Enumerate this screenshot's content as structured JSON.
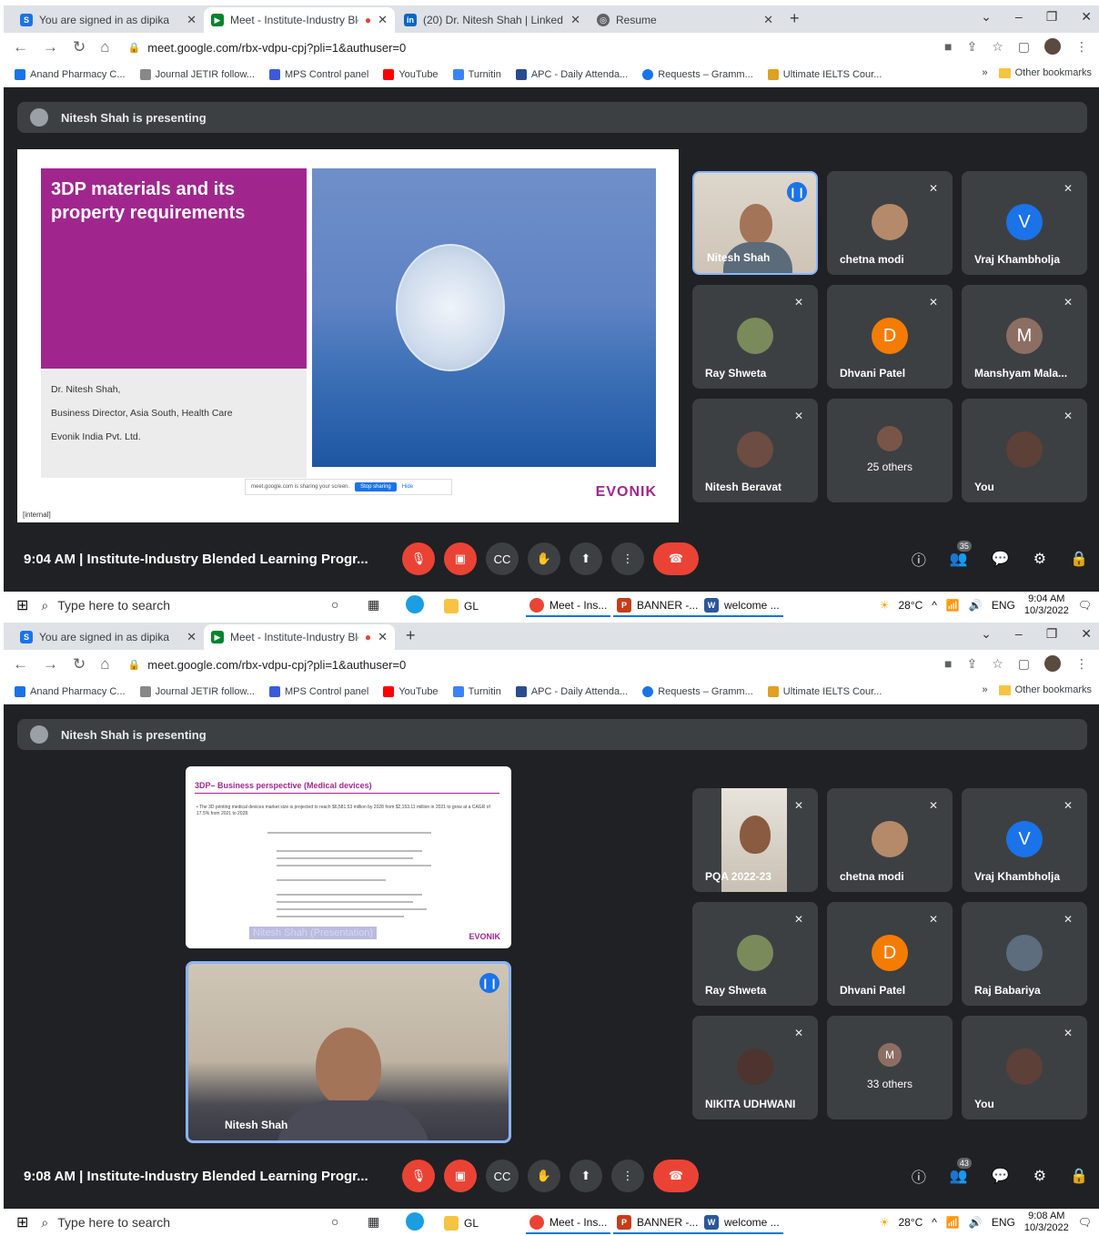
{
  "shots": [
    {
      "tabs": [
        "You are signed in as dipika",
        "Meet - Institute-Industry Ble",
        "(20) Dr. Nitesh Shah | LinkedIn",
        "Resume"
      ],
      "url": "meet.google.com/rbx-vdpu-cpj?pli=1&authuser=0",
      "presenting": "Nitesh Shah is presenting",
      "time_title": "9:04 AM  |  Institute-Industry Blended Learning Progr...",
      "people_count": "35",
      "tiles": [
        "Nitesh Shah",
        "chetna modi",
        "Vraj Khambholja",
        "Ray Shweta",
        "Dhvani Patel",
        "Manshyam Mala...",
        "Nitesh Beravat",
        "25 others",
        "You"
      ],
      "avatar_letters": [
        "V",
        "D",
        "M"
      ],
      "clock_time": "9:04 AM",
      "clock_date": "10/3/2022"
    },
    {
      "tabs": [
        "You are signed in as dipika",
        "Meet - Institute-Industry Ble"
      ],
      "url": "meet.google.com/rbx-vdpu-cpj?pli=1&authuser=0",
      "presenting": "Nitesh Shah is presenting",
      "time_title": "9:08 AM  |  Institute-Industry Blended Learning Progr...",
      "people_count": "43",
      "tiles": [
        "PQA 2022-23",
        "chetna modi",
        "Vraj Khambholja",
        "Ray Shweta",
        "Dhvani Patel",
        "Raj Babariya",
        "NIKITA UDHWANI",
        "33 others",
        "You"
      ],
      "avatar_letters": [
        "V",
        "D",
        "M"
      ],
      "main_video_name": "Nitesh Shah",
      "clock_time": "9:08 AM",
      "clock_date": "10/3/2022"
    }
  ],
  "bookmarks": [
    "Anand Pharmacy C...",
    "Journal JETIR follow...",
    "MPS Control panel",
    "YouTube",
    "Turnitin",
    "APC - Daily Attenda...",
    "Requests – Gramm...",
    "Ultimate IELTS Cour..."
  ],
  "other_bookmarks": "Other bookmarks",
  "taskbar": {
    "search": "Type here to search",
    "apps": [
      "GL",
      "Meet - Ins...",
      "BANNER -...",
      "welcome ..."
    ],
    "temp": "28°C",
    "lang": "ENG"
  },
  "slide1": {
    "title": "3DP materials and its property requirements",
    "author_lines": [
      "Dr. Nitesh Shah,",
      "Business Director, Asia South, Health Care",
      "Evonik India Pvt. Ltd."
    ],
    "footer": "[internal]",
    "share_msg": "meet.google.com is sharing your screen.",
    "stop": "Stop sharing",
    "hide": "Hide",
    "logo": "EVONIK"
  },
  "slide2": {
    "title": "3DP– Business perspective (Medical devices)",
    "bullet": "• The 3D printing medical devices market size is projected to reach $6,581.53 million by 2028 from $2,153.11 million in 2021 to grow at a CAGR of 17.5% from 2021 to 2028.",
    "caption": "Nitesh Shah (Presentation)",
    "logo": "EVONIK"
  },
  "colors": {
    "meet_bg": "#202124",
    "tile_bg": "#3c4043",
    "end_call": "#ea4335",
    "accent": "#1a73e8",
    "evonik": "#a0268e"
  }
}
